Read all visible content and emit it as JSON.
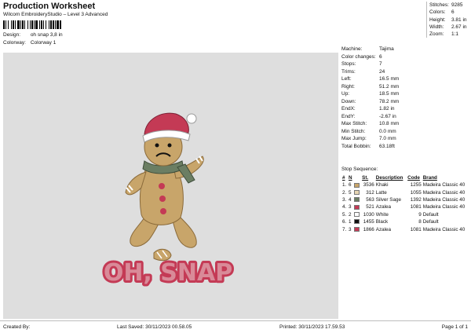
{
  "header": {
    "title": "Production Worksheet",
    "subtitle": "Wilcom EmbroideryStudio – Level 3 Advanced",
    "design_label": "Design:",
    "design_value": "oh snap 3,8 in",
    "colorway_label": "Colorway:",
    "colorway_value": "Colorway 1"
  },
  "stats": [
    {
      "label": "Stitches:",
      "value": "9285"
    },
    {
      "label": "Colors:",
      "value": "6"
    },
    {
      "label": "Height:",
      "value": "3.81 in"
    },
    {
      "label": "Width:",
      "value": "2.67 in"
    },
    {
      "label": "Zoom:",
      "value": "1:1"
    }
  ],
  "info": [
    {
      "label": "Machine:",
      "value": "Tajima"
    },
    {
      "label": "Color changes:",
      "value": "6"
    },
    {
      "label": "Stops:",
      "value": "7"
    },
    {
      "label": "Trims:",
      "value": "24"
    },
    {
      "label": "Left:",
      "value": "16.5 mm"
    },
    {
      "label": "Right:",
      "value": "51.2 mm"
    },
    {
      "label": "Up:",
      "value": "18.5 mm"
    },
    {
      "label": "Down:",
      "value": "78.2 mm"
    },
    {
      "label": "EndX:",
      "value": "1.82 in"
    },
    {
      "label": "EndY:",
      "value": "-2.67 in"
    },
    {
      "label": "Max Stitch:",
      "value": "10.8 mm"
    },
    {
      "label": "Min Stitch:",
      "value": "0.0 mm"
    },
    {
      "label": "Max Jump:",
      "value": "7.0 mm"
    },
    {
      "label": "Total Bobbin:",
      "value": "63.18ft"
    }
  ],
  "stop_sequence": {
    "title": "Stop Sequence:",
    "headers": [
      "#",
      "N",
      "",
      "St.",
      "Description",
      "Code",
      "Brand"
    ],
    "rows": [
      {
        "idx": "1.",
        "n": "6",
        "color": "#c8a56a",
        "st": "3536",
        "desc": "Khaki",
        "code": "1255",
        "brand": "Madeira Classic 40"
      },
      {
        "idx": "2.",
        "n": "5",
        "color": "#e6d6b3",
        "st": "312",
        "desc": "Latte",
        "code": "1055",
        "brand": "Madeira Classic 40"
      },
      {
        "idx": "3.",
        "n": "4",
        "color": "#6b7e63",
        "st": "563",
        "desc": "Silver Sage",
        "code": "1392",
        "brand": "Madeira Classic 40"
      },
      {
        "idx": "4.",
        "n": "3",
        "color": "#c43a55",
        "st": "521",
        "desc": "Azalea",
        "code": "1081",
        "brand": "Madeira Classic 40"
      },
      {
        "idx": "5.",
        "n": "2",
        "color": "#ffffff",
        "st": "1030",
        "desc": "White",
        "code": "9",
        "brand": "Default"
      },
      {
        "idx": "6.",
        "n": "1",
        "color": "#111111",
        "st": "1455",
        "desc": "Black",
        "code": "8",
        "brand": "Default"
      },
      {
        "idx": "7.",
        "n": "3",
        "color": "#c43a55",
        "st": "1866",
        "desc": "Azalea",
        "code": "1081",
        "brand": "Madeira Classic 40"
      }
    ]
  },
  "design_text": "OH, SNAP",
  "footer": {
    "created_by": "Created By:",
    "last_saved": "Last Saved: 30/11/2023 00.58.05",
    "printed": "Printed: 30/11/2023 17.59.53",
    "page": "Page 1 of 1"
  }
}
